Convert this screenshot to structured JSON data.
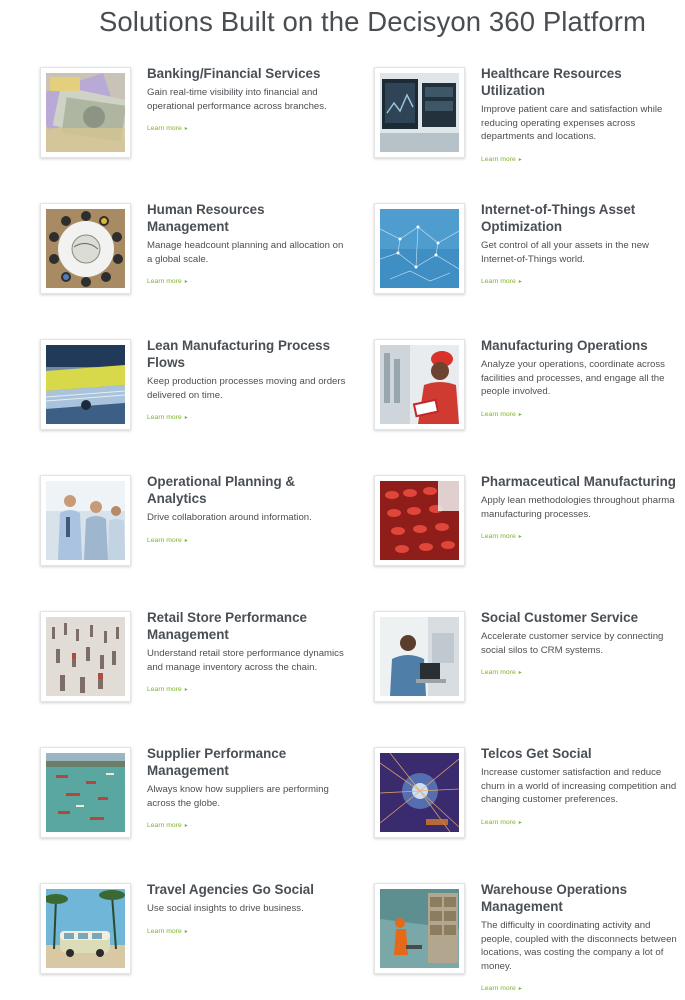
{
  "page": {
    "title": "Solutions Built on the Decisyon 360 Platform"
  },
  "colors": {
    "accent": "#7fb32b",
    "heading": "#4a4f55",
    "text": "#4c4f53"
  },
  "solutions": [
    {
      "title": "Banking/Financial Services",
      "description": "Gain real-time visibility into financial and operational performance across branches.",
      "link": "Learn more",
      "image": "money-image"
    },
    {
      "title": "Healthcare Resources Utilization",
      "description": "Improve patient care and satisfaction while reducing operating expenses across departments and locations.",
      "link": "Learn more",
      "image": "medical-monitor-image"
    },
    {
      "title": "Human Resources Management",
      "description": "Manage headcount planning and allocation on a global scale.",
      "link": "Learn more",
      "image": "globe-meeting-image"
    },
    {
      "title": "Internet-of-Things Asset Optimization",
      "description": "Get control of all your assets in the new Internet-of-Things world.",
      "link": "Learn more",
      "image": "network-image"
    },
    {
      "title": "Lean Manufacturing Process Flows",
      "description": "Keep production processes moving and orders delivered on time.",
      "link": "Learn more",
      "image": "conveyor-image"
    },
    {
      "title": "Manufacturing Operations",
      "description": "Analyze your operations, coordinate across facilities and processes, and engage all the people involved.",
      "link": "Learn more",
      "image": "hardhat-worker-image"
    },
    {
      "title": "Operational Planning & Analytics",
      "description": "Drive collaboration around information.",
      "link": "Learn more",
      "image": "business-team-image"
    },
    {
      "title": "Pharmaceutical Manufacturing",
      "description": "Apply lean methodologies throughout pharma manufacturing processes.",
      "link": "Learn more",
      "image": "pills-image"
    },
    {
      "title": "Retail Store Performance Management",
      "description": "Understand retail store performance dynamics and manage inventory across the chain.",
      "link": "Learn more",
      "image": "crowd-image"
    },
    {
      "title": "Social Customer Service",
      "description": "Accelerate customer service by connecting social silos to CRM systems.",
      "link": "Learn more",
      "image": "call-center-image"
    },
    {
      "title": "Supplier Performance Management",
      "description": "Always know how suppliers are performing across the globe.",
      "link": "Learn more",
      "image": "harbor-boats-image"
    },
    {
      "title": "Telcos Get Social",
      "description": "Increase customer satisfaction and reduce churn in a world of increasing competition and changing customer preferences.",
      "link": "Learn more",
      "image": "digital-network-image"
    },
    {
      "title": "Travel Agencies Go Social",
      "description": "Use social insights to drive business.",
      "link": "Learn more",
      "image": "van-beach-image"
    },
    {
      "title": "Warehouse Operations Management",
      "description": "The difficulty in coordinating activity and people, coupled with the disconnects between locations, was costing the company a lot of money.",
      "link": "Learn more",
      "image": "warehouse-image"
    }
  ]
}
